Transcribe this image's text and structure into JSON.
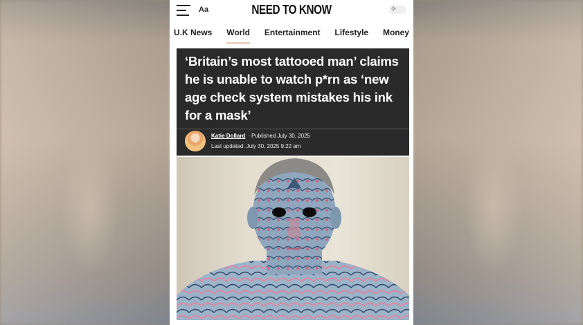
{
  "header": {
    "font_size_label": "Aa",
    "site_title": "NEED TO KNOW",
    "menu_icon": "hamburger-menu-icon",
    "theme_icon": "sun-icon"
  },
  "nav": {
    "items": [
      {
        "label": "U.K News",
        "active": false
      },
      {
        "label": "World",
        "active": true
      },
      {
        "label": "Entertainment",
        "active": false
      },
      {
        "label": "Lifestyle",
        "active": false
      },
      {
        "label": "Money",
        "active": false
      }
    ]
  },
  "article": {
    "headline": "‘Britain’s most tattooed man’ claims he is unable to watch p*rn as ‘new age check system mistakes his ink for a mask’",
    "author": "Katie Dollard",
    "published": "Published July 30, 2025",
    "updated": "Last updated: July 30, 2025 9:22 am"
  },
  "colors": {
    "headline_bg": "#2a2a2a",
    "nav_active_underline": "#ecd3c2"
  }
}
